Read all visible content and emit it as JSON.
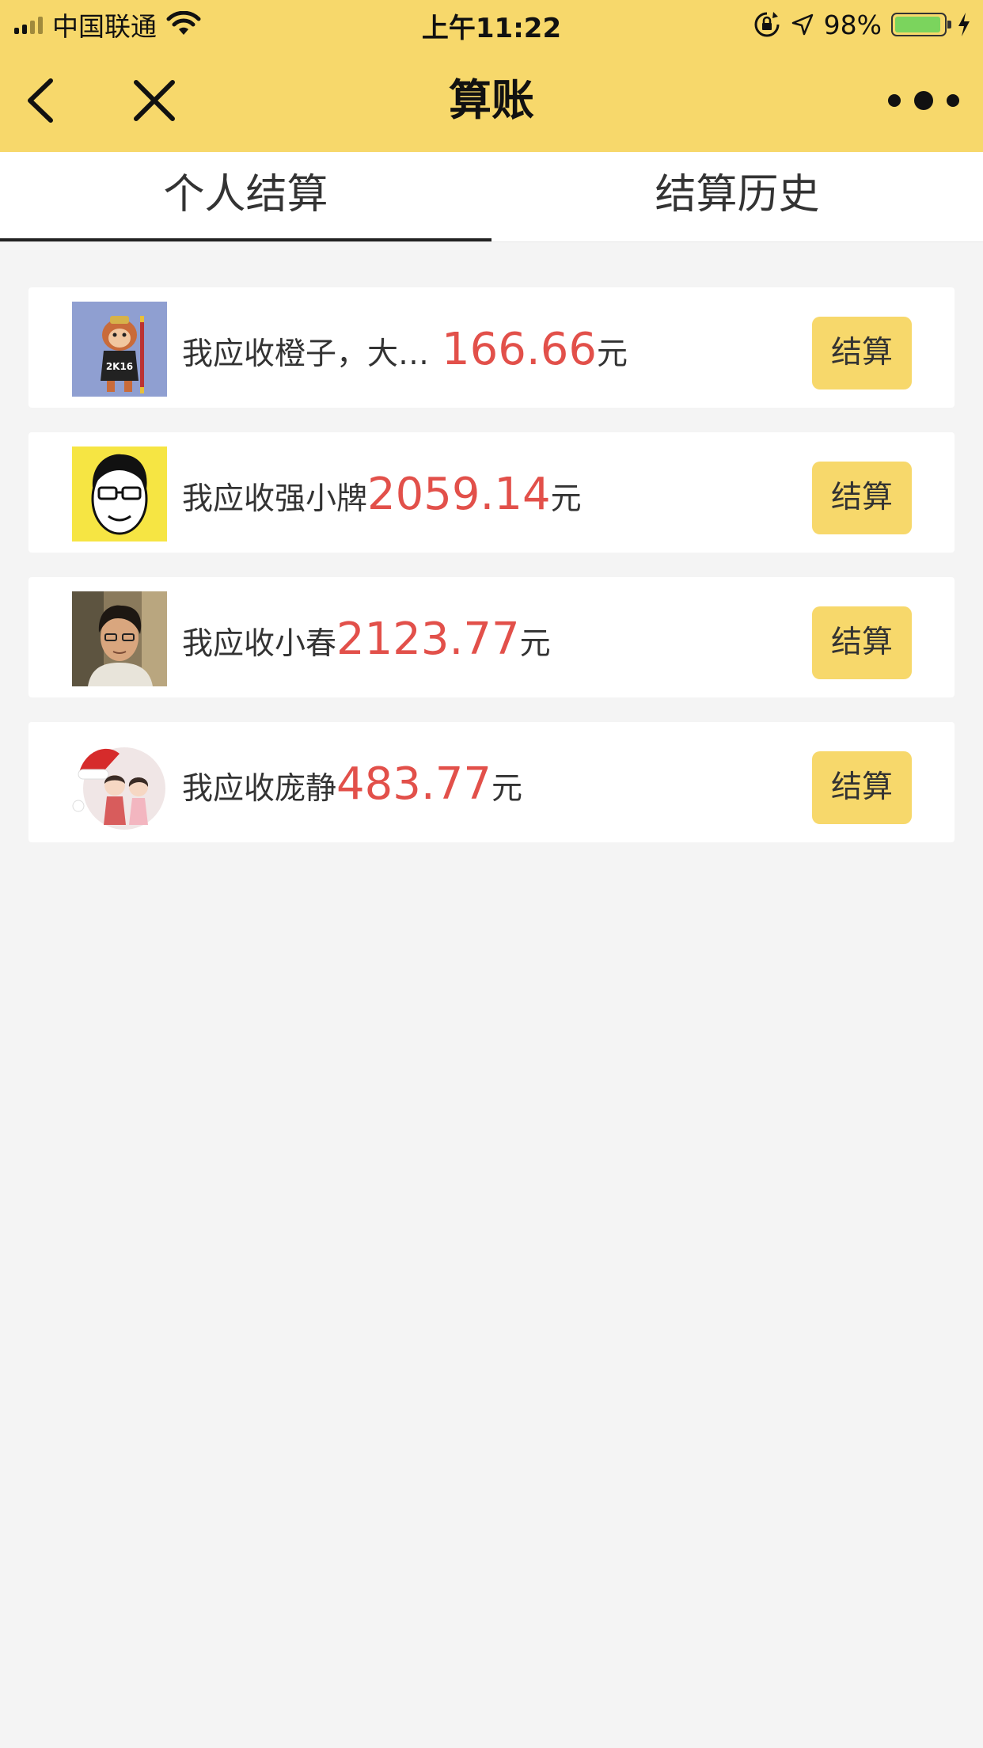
{
  "status_bar": {
    "carrier": "中国联通",
    "time": "上午11:22",
    "battery_percent": "98%"
  },
  "nav": {
    "title": "算账",
    "icons": [
      "back-icon",
      "close-icon",
      "more-icon"
    ]
  },
  "tabs": [
    {
      "label": "个人结算",
      "active": true
    },
    {
      "label": "结算历史",
      "active": false
    }
  ],
  "settlements": [
    {
      "text": "我应收橙子，大…",
      "amount": "166.66",
      "unit": "元",
      "button": "结算",
      "avatar": "monkey-avatar"
    },
    {
      "text": "我应收强小牌",
      "amount": "2059.14",
      "unit": "元",
      "button": "结算",
      "avatar": "cartoon-face-avatar"
    },
    {
      "text": "我应收小春",
      "amount": "2123.77",
      "unit": "元",
      "button": "结算",
      "avatar": "photo-avatar"
    },
    {
      "text": "我应收庞静",
      "amount": "483.77",
      "unit": "元",
      "button": "结算",
      "avatar": "couple-avatar"
    }
  ],
  "colors": {
    "header": "#f7d86b",
    "amount": "#e2504a",
    "background": "#f4f4f4"
  }
}
